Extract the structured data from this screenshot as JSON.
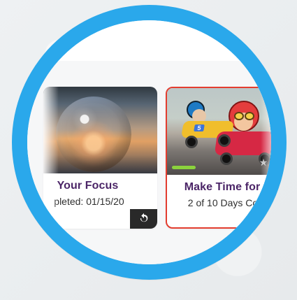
{
  "theme": {
    "ring_color": "#2aa8eb",
    "selected_border": "#e33d2f",
    "title_color": "#4b2567",
    "progress_color": "#8bd23d"
  },
  "cards": [
    {
      "title": "Your Focus",
      "subtitle": "pleted: 01/15/20",
      "action_icon": "refresh-icon",
      "state": "completed"
    },
    {
      "title": "Make Time for",
      "subtitle": "2 of 10 Days Co",
      "action_icon": "badge-icon",
      "progress_fraction": 0.2,
      "state": "in-progress"
    }
  ]
}
